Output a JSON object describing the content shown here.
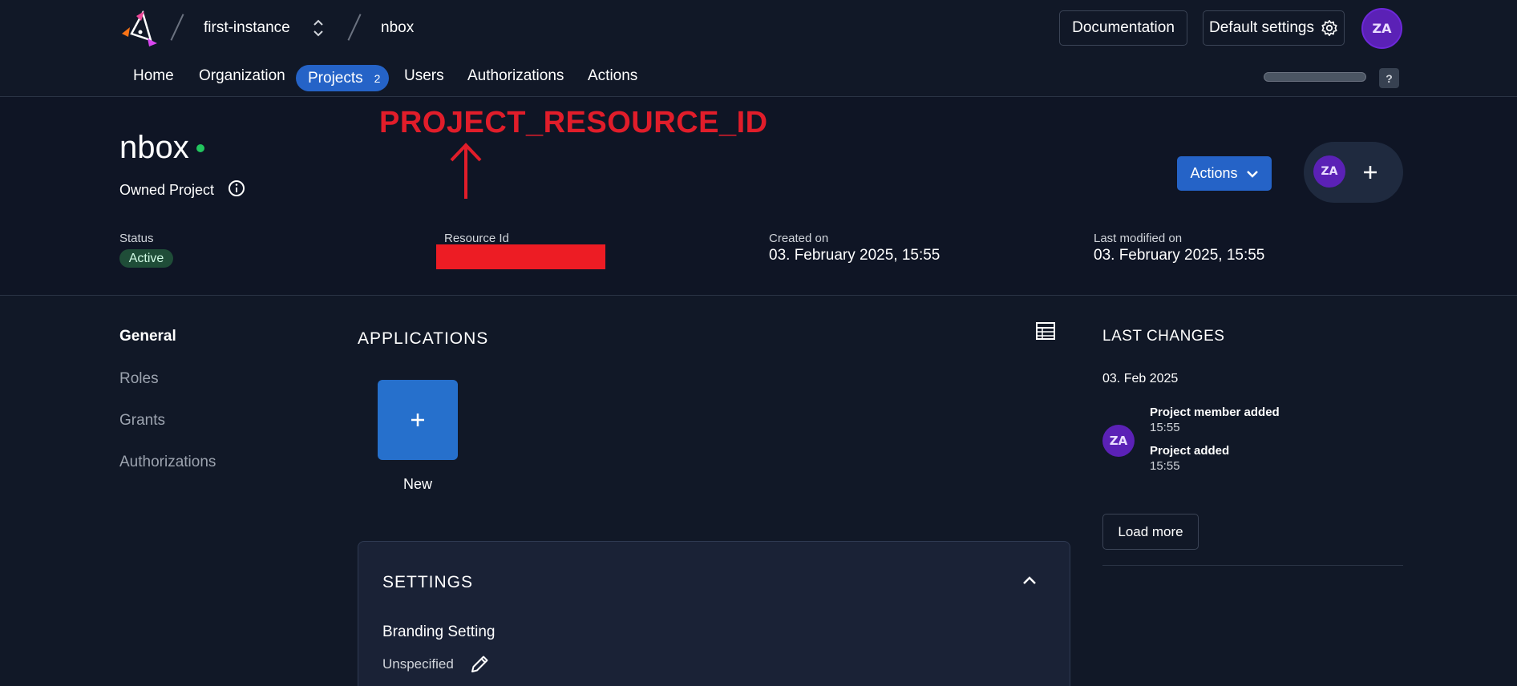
{
  "breadcrumb": {
    "instance": "first-instance",
    "project": "nbox"
  },
  "topbar": {
    "documentation_label": "Documentation",
    "default_settings_label": "Default settings",
    "user_initials": "ZA"
  },
  "nav": {
    "home": "Home",
    "organization": "Organization",
    "projects": "Projects",
    "projects_count": "2",
    "users": "Users",
    "authorizations": "Authorizations",
    "actions": "Actions",
    "help": "?"
  },
  "project": {
    "name": "nbox",
    "type": "Owned Project",
    "status_label": "Status",
    "status_value": "Active",
    "resource_id_label": "Resource Id",
    "created_label": "Created on",
    "created_value": "03. February 2025, 15:55",
    "modified_label": "Last modified on",
    "modified_value": "03. February 2025, 15:55",
    "actions_label": "Actions",
    "member_initials": "ZA"
  },
  "annotation": {
    "text": "PROJECT_RESOURCE_ID",
    "color": "#e11d2a"
  },
  "sidebar": {
    "items": [
      "General",
      "Roles",
      "Grants",
      "Authorizations"
    ]
  },
  "applications": {
    "title": "APPLICATIONS",
    "new_label": "New"
  },
  "settings": {
    "title": "SETTINGS",
    "branding_title": "Branding Setting",
    "branding_value": "Unspecified"
  },
  "changes": {
    "title": "LAST CHANGES",
    "date": "03. Feb 2025",
    "avatar_initials": "ZA",
    "entries": [
      {
        "title": "Project member added",
        "time": "15:55"
      },
      {
        "title": "Project added",
        "time": "15:55"
      }
    ],
    "load_more": "Load more"
  },
  "colors": {
    "background": "#111827",
    "accent": "#2563c7",
    "status_active": "#22c55e",
    "avatar": "#5b21b6"
  }
}
